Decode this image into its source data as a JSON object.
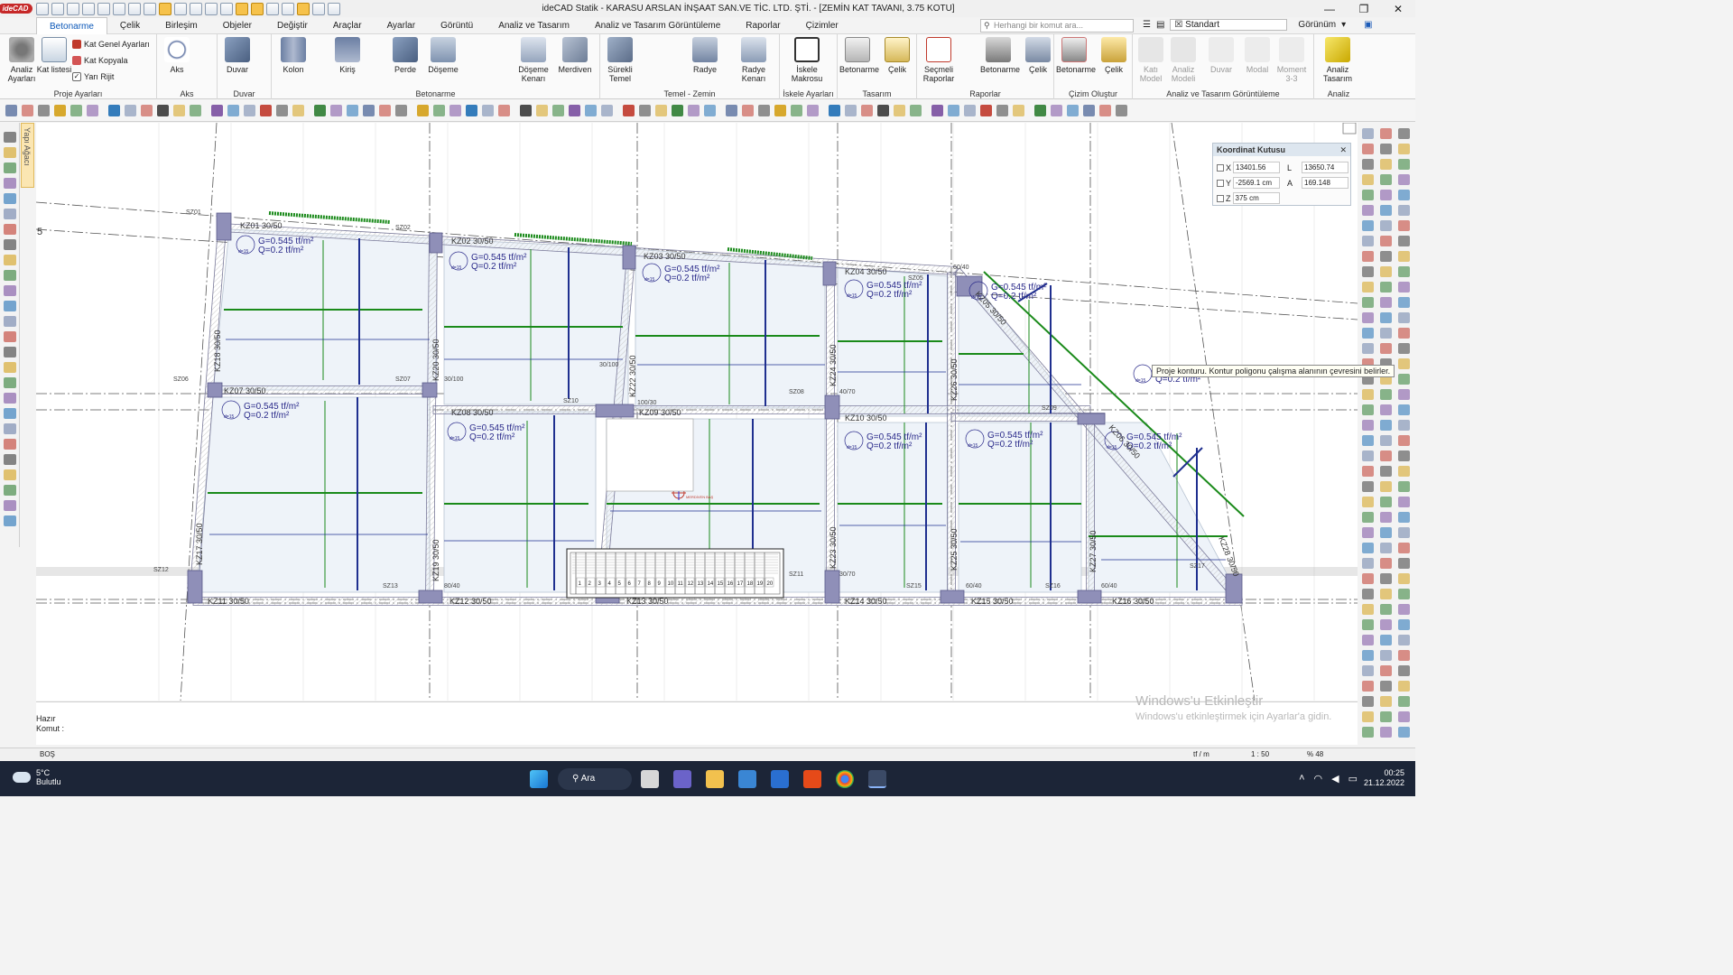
{
  "window": {
    "logo": "ideCAD",
    "title": "ideCAD Statik - KARASU ARSLAN İNŞAAT SAN.VE TİC. LTD. ŞTİ. - [ZEMİN KAT TAVANI,  3.75 KOTU]",
    "minimize": "—",
    "restore": "❐",
    "close": "✕"
  },
  "menu": {
    "tabs": [
      "Betonarme",
      "Çelik",
      "Birleşim",
      "Objeler",
      "Değiştir",
      "Araçlar",
      "Ayarlar",
      "Görüntü",
      "Analiz ve Tasarım",
      "Analiz ve Tasarım Görüntüleme",
      "Raporlar",
      "Çizimler"
    ],
    "active_tab": "Betonarme",
    "search_placeholder": "Herhangi bir komut ara...",
    "style_select": "Standart",
    "view_label": "Görünüm"
  },
  "ribbon": {
    "groups": {
      "proje": "Proje Ayarları",
      "aks": "Aks",
      "duvar": "Duvar",
      "betonarme": "Betonarme",
      "temel": "Temel - Zemin",
      "iskele": "İskele Ayarları",
      "tasarim": "Tasarım",
      "raporlar": "Raporlar",
      "cizim": "Çizim Oluştur",
      "analizgor": "Analiz ve Tasarım Görüntüleme",
      "analiz": "Analiz"
    },
    "buttons": {
      "analiz_ayarlari": "Analiz Ayarları",
      "kat_listesi": "Kat listesi",
      "kat_genel": "Kat Genel Ayarları",
      "kat_kopyala": "Kat Kopyala",
      "yari_rijit": "Yarı Rijit",
      "aks": "Aks",
      "duvar": "Duvar",
      "kolon": "Kolon",
      "kiris": "Kiriş",
      "perde": "Perde",
      "doseme": "Döşeme",
      "doseme_kenari": "Döşeme Kenarı",
      "merdiven": "Merdiven",
      "surekli_temel": "Sürekli Temel",
      "radye": "Radye",
      "radye_kenari": "Radye Kenarı",
      "iskele_makrosu": "İskele Makrosu",
      "t_betonarme": "Betonarme",
      "t_celik": "Çelik",
      "secmeli_raporlar": "Seçmeli Raporlar",
      "r_betonarme": "Betonarme",
      "r_celik": "Çelik",
      "c_betonarme": "Betonarme",
      "c_celik": "Çelik",
      "kati_model": "Katı Model",
      "analiz_modeli": "Analiz Modeli",
      "g_duvar": "Duvar",
      "modal": "Modal",
      "moment": "Moment 3-3",
      "analiz_tasarim": "Analiz Tasarım"
    }
  },
  "side_panel": {
    "label": "Yapı Ağacı"
  },
  "coord_box": {
    "title": "Koordinat Kutusu",
    "x_label": "X",
    "x_value": "13401.56 cm",
    "y_label": "Y",
    "y_value": "-2569.1 cm",
    "z_label": "Z",
    "z_value": "375 cm",
    "l_label": "L",
    "l_value": "13650.74 cm",
    "a_label": "A",
    "a_value": "169.148"
  },
  "tooltip": "Proje konturu. Kontur poligonu çalışma alanının çevresini belirler.",
  "drawing": {
    "axis_label": "5",
    "load_g": "G=0.545 tf/m²",
    "load_q": "Q=0.2 tf/m²",
    "slab_tag": "d=15",
    "mid_beam_label": "30/100",
    "beams": [
      {
        "id": "KZ01 30/50"
      },
      {
        "id": "KZ02 30/50"
      },
      {
        "id": "KZ03 30/50"
      },
      {
        "id": "KZ04 30/50"
      },
      {
        "id": "KZ05 30/50"
      },
      {
        "id": "KZ06 30/50"
      },
      {
        "id": "KZ07 30/50"
      },
      {
        "id": "KZ08 30/50"
      },
      {
        "id": "KZ09 30/50"
      },
      {
        "id": "KZ10 30/50"
      },
      {
        "id": "KZ11 30/50"
      },
      {
        "id": "KZ12 30/50"
      },
      {
        "id": "KZ13 30/50"
      },
      {
        "id": "KZ14 30/50"
      },
      {
        "id": "KZ15 30/50"
      },
      {
        "id": "KZ16 30/50"
      },
      {
        "id": "KZ17 30/50"
      },
      {
        "id": "KZ18 30/50"
      },
      {
        "id": "KZ19 30/50"
      },
      {
        "id": "KZ20 30/50"
      },
      {
        "id": "KZ22 30/50"
      },
      {
        "id": "KZ23 30/50"
      },
      {
        "id": "KZ24 30/50"
      },
      {
        "id": "KZ25 30/50"
      },
      {
        "id": "KZ26 30/50"
      },
      {
        "id": "KZ27 30/50"
      },
      {
        "id": "KZ28 30/50"
      }
    ],
    "column_labels": [
      "SZ01",
      "SZ02",
      "SZ05",
      "SZ06",
      "SZ07",
      "SZ08",
      "SZ09",
      "SZ10",
      "SZ11",
      "SZ12",
      "SZ13",
      "SZ15",
      "SZ16",
      "SZ17"
    ],
    "column_dims": [
      "60/40",
      "40/70",
      "100/30",
      "30/100",
      "80/40",
      "60/40",
      "60/40",
      "30/70",
      "60/40"
    ],
    "stair_steps": [
      "1",
      "2",
      "3",
      "4",
      "5",
      "6",
      "7",
      "8",
      "9",
      "10",
      "11",
      "12",
      "13",
      "14",
      "15",
      "16",
      "17",
      "18",
      "19",
      "20"
    ],
    "marker_label": "MERDİVEN BAŞ"
  },
  "command": {
    "status": "Hazır",
    "prompt": "Komut :"
  },
  "statusbar": {
    "left": "BOŞ",
    "unit": "tf / m",
    "scale": "1 : 50",
    "zoom": "% 48"
  },
  "watermark": {
    "line1": "Windows'u Etkinleştir",
    "line2": "Windows'u etkinleştirmek için Ayarlar'a gidin."
  },
  "taskbar": {
    "temperature": "5°C",
    "weather": "Bulutlu",
    "search": "Ara",
    "time": "00:25",
    "date": "21.12.2022"
  },
  "colors": {
    "beam_fill": "#eaeaea",
    "slab_fill": "#eef3f9",
    "green": "#1a8a1a",
    "blue": "#1f2f8f",
    "text_blue": "#2a2a8a",
    "column": "#8f8fb8"
  }
}
